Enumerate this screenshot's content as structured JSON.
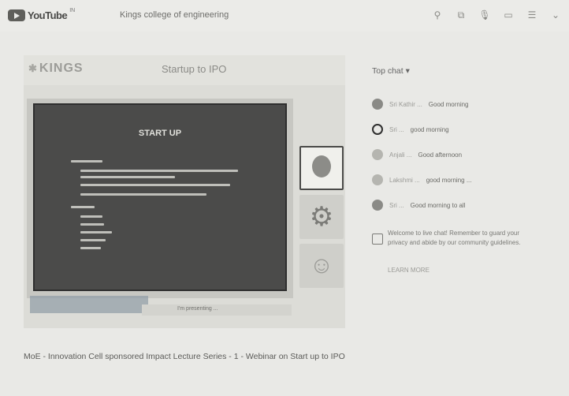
{
  "app": {
    "logo": "YouTube",
    "region": "IN"
  },
  "channel": {
    "name": "Kings college of engineering"
  },
  "player": {
    "brand": "KINGS",
    "slide_title": "Startup to IPO",
    "slide_heading": "START UP",
    "caption": "I'm presenting ...",
    "participants": [
      "participant-video",
      "participant-logo",
      "participant-avatar"
    ]
  },
  "video": {
    "title": "MoE - Innovation Cell sponsored Impact Lecture Series - 1 - Webinar on Start up to IPO"
  },
  "chat": {
    "header": "Top chat ▾",
    "messages": [
      {
        "name": "Sri Kathir ...",
        "text": "Good morning",
        "style": "dark"
      },
      {
        "name": "Sri ...",
        "text": "good morning",
        "style": "ring"
      },
      {
        "name": "Anjali ...",
        "text": "Good afternoon",
        "style": "light"
      },
      {
        "name": "Lakshmi ...",
        "text": "good morning ...",
        "style": "light"
      },
      {
        "name": "Sri ...",
        "text": "Good morning to all",
        "style": "dark"
      }
    ],
    "info": "Welcome to live chat! Remember to guard your privacy and abide by our community guidelines.",
    "learn_more": "LEARN MORE"
  },
  "icons": [
    "search-icon",
    "share-icon",
    "mic-icon",
    "cast-icon",
    "menu-icon",
    "chevron-down-icon"
  ]
}
